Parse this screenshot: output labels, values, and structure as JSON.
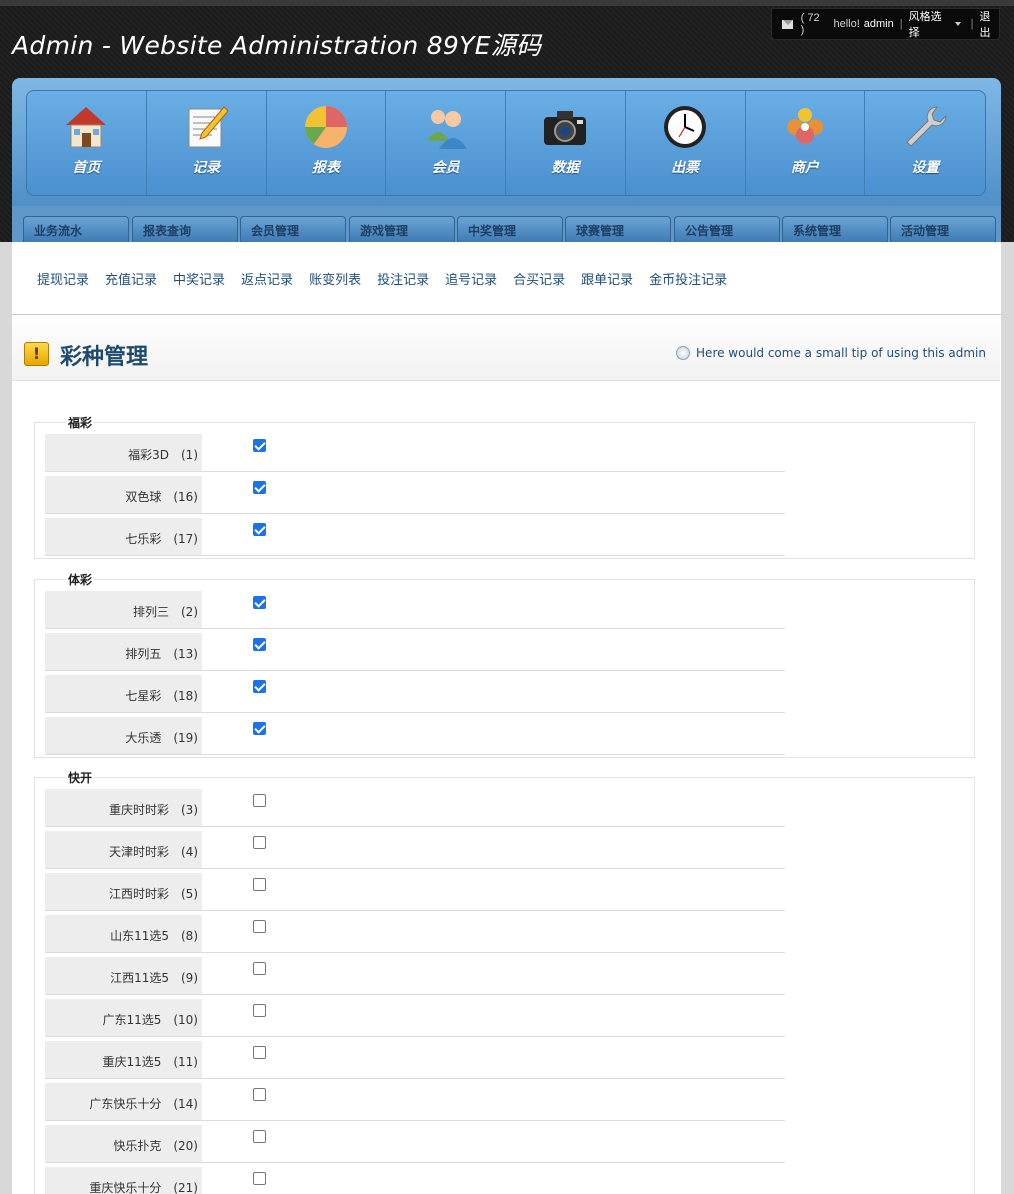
{
  "header": {
    "title": "Admin - Website Administration 89YE源码",
    "user": {
      "mail_count": "( 72 )",
      "greeting": "hello!",
      "username": "admin",
      "style_select": "风格选择",
      "logout": "退出"
    }
  },
  "nav_icons": [
    {
      "label": "首页",
      "icon": "home-icon"
    },
    {
      "label": "记录",
      "icon": "notepad-icon"
    },
    {
      "label": "报表",
      "icon": "pie-chart-icon"
    },
    {
      "label": "会员",
      "icon": "users-icon"
    },
    {
      "label": "数据",
      "icon": "camera-icon"
    },
    {
      "label": "出票",
      "icon": "clock-icon"
    },
    {
      "label": "商户",
      "icon": "merchant-icon"
    },
    {
      "label": "设置",
      "icon": "wrench-icon"
    }
  ],
  "tabs": [
    "业务流水",
    "报表查询",
    "会员管理",
    "游戏管理",
    "中奖管理",
    "球赛管理",
    "公告管理",
    "系统管理",
    "活动管理"
  ],
  "subnav": [
    "提现记录",
    "充值记录",
    "中奖记录",
    "返点记录",
    "账变列表",
    "投注记录",
    "追号记录",
    "合买记录",
    "跟单记录",
    "金币投注记录"
  ],
  "page": {
    "title": "彩种管理",
    "tip": "Here would come a small tip of using this admin"
  },
  "groups": [
    {
      "label": "福彩",
      "items": [
        {
          "name": "福彩3D",
          "id": "(1)",
          "checked": true
        },
        {
          "name": "双色球",
          "id": "(16)",
          "checked": true
        },
        {
          "name": "七乐彩",
          "id": "(17)",
          "checked": true
        }
      ]
    },
    {
      "label": "体彩",
      "items": [
        {
          "name": "排列三",
          "id": "(2)",
          "checked": true
        },
        {
          "name": "排列五",
          "id": "(13)",
          "checked": true
        },
        {
          "name": "七星彩",
          "id": "(18)",
          "checked": true
        },
        {
          "name": "大乐透",
          "id": "(19)",
          "checked": true
        }
      ]
    },
    {
      "label": "快开",
      "items": [
        {
          "name": "重庆时时彩",
          "id": "(3)",
          "checked": false
        },
        {
          "name": "天津时时彩",
          "id": "(4)",
          "checked": false
        },
        {
          "name": "江西时时彩",
          "id": "(5)",
          "checked": false
        },
        {
          "name": "山东11选5",
          "id": "(8)",
          "checked": false
        },
        {
          "name": "江西11选5",
          "id": "(9)",
          "checked": false
        },
        {
          "name": "广东11选5",
          "id": "(10)",
          "checked": false
        },
        {
          "name": "重庆11选5",
          "id": "(11)",
          "checked": false
        },
        {
          "name": "广东快乐十分",
          "id": "(14)",
          "checked": false
        },
        {
          "name": "快乐扑克",
          "id": "(20)",
          "checked": false
        },
        {
          "name": "重庆快乐十分",
          "id": "(21)",
          "checked": false
        }
      ]
    }
  ]
}
